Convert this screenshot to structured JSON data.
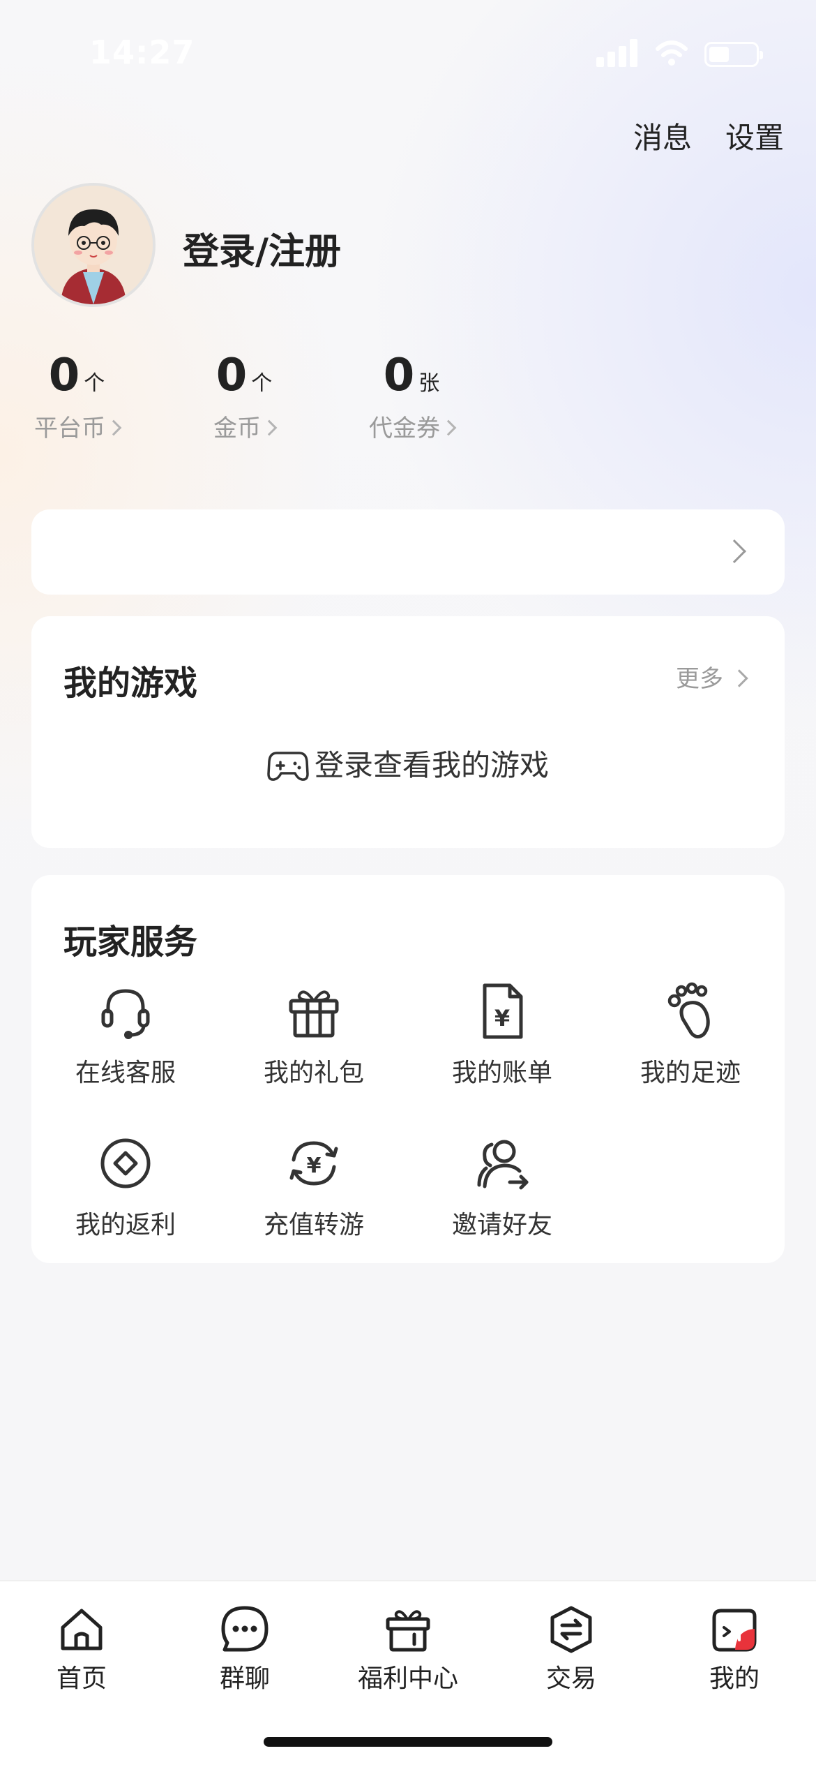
{
  "status_bar": {
    "time": "14:27"
  },
  "header": {
    "messages_label": "消息",
    "settings_label": "设置"
  },
  "profile": {
    "login_label": "登录/注册"
  },
  "stats": [
    {
      "value": "0",
      "unit": "个",
      "label": "平台币"
    },
    {
      "value": "0",
      "unit": "个",
      "label": "金币"
    },
    {
      "value": "0",
      "unit": "张",
      "label": "代金券"
    }
  ],
  "my_games": {
    "title": "我的游戏",
    "more_label": "更多",
    "empty_label": "登录查看我的游戏"
  },
  "services": {
    "title": "玩家服务",
    "items": [
      {
        "label": "在线客服",
        "icon": "headset-icon"
      },
      {
        "label": "我的礼包",
        "icon": "gift-icon"
      },
      {
        "label": "我的账单",
        "icon": "bill-icon"
      },
      {
        "label": "我的足迹",
        "icon": "footprint-icon"
      },
      {
        "label": "我的返利",
        "icon": "rebate-icon"
      },
      {
        "label": "充值转游",
        "icon": "recharge-transfer-icon"
      },
      {
        "label": "邀请好友",
        "icon": "invite-friend-icon"
      }
    ]
  },
  "tab_bar": {
    "items": [
      {
        "label": "首页",
        "icon": "home-icon"
      },
      {
        "label": "群聊",
        "icon": "chat-icon"
      },
      {
        "label": "福利中心",
        "icon": "gift-box-icon"
      },
      {
        "label": "交易",
        "icon": "trade-icon"
      },
      {
        "label": "我的",
        "icon": "profile-icon"
      }
    ],
    "active_index": 4
  },
  "colors": {
    "accent": "#e8333b",
    "text": "#222222",
    "muted": "#9a9a9a"
  }
}
